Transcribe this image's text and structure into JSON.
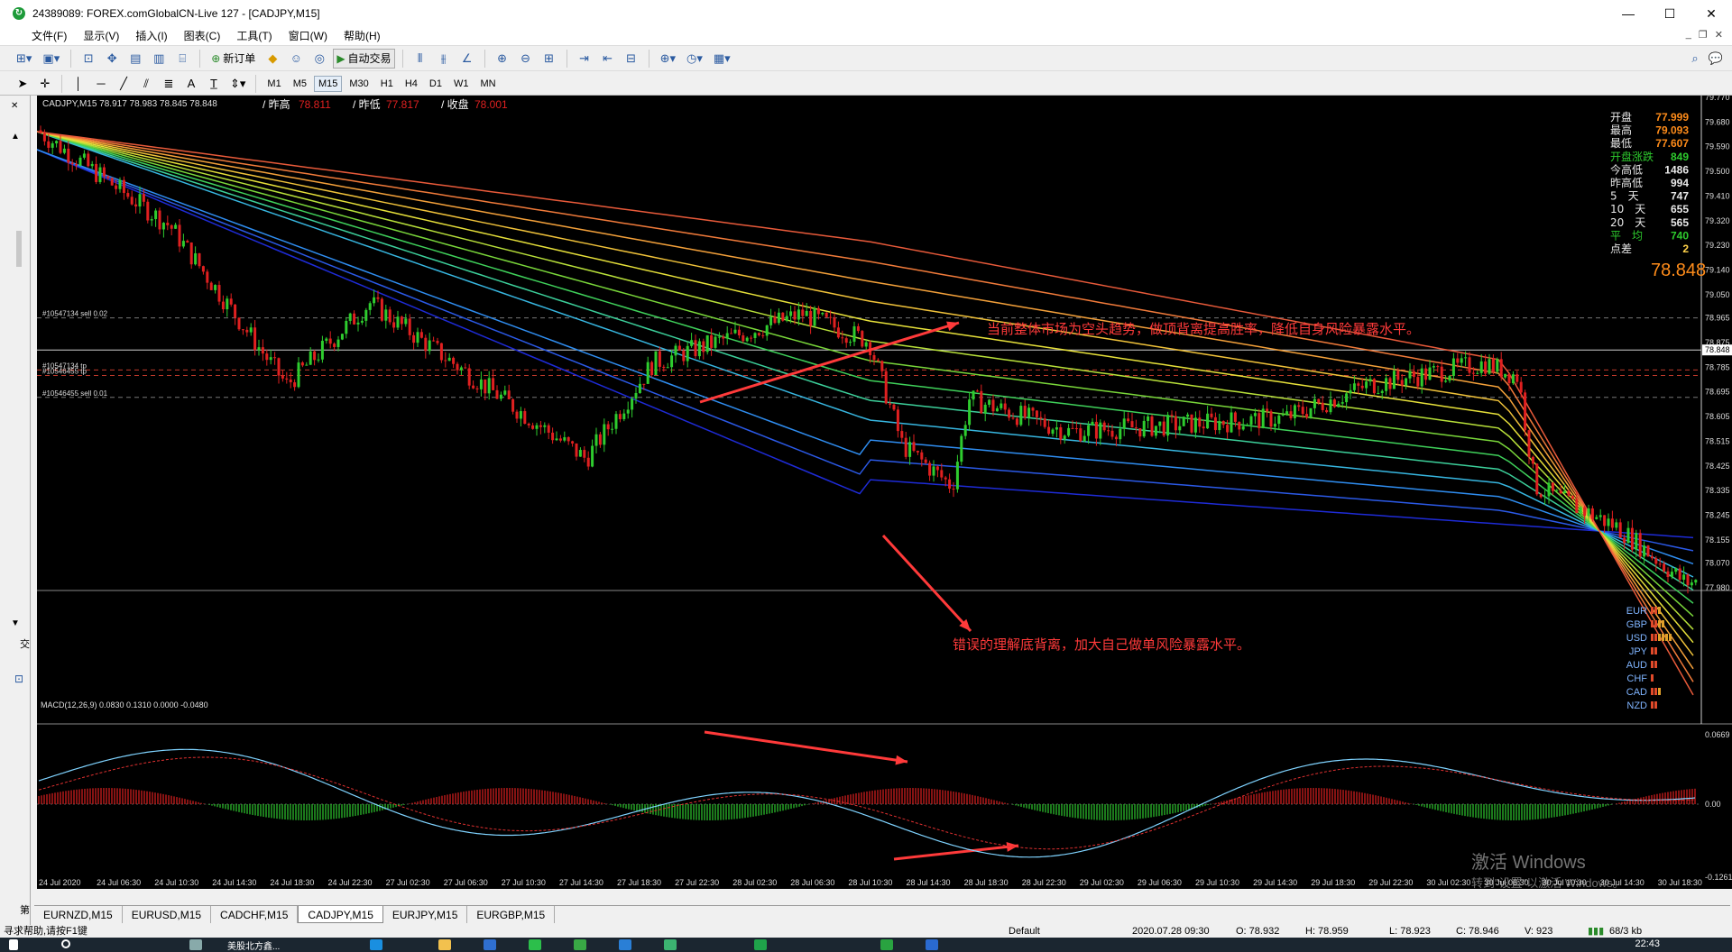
{
  "window": {
    "title": "24389089: FOREX.comGlobalCN-Live 127 - [CADJPY,M15]",
    "controls": [
      "—",
      "☐",
      "✕"
    ]
  },
  "menu": {
    "items": [
      "文件(F)",
      "显示(V)",
      "插入(I)",
      "图表(C)",
      "工具(T)",
      "窗口(W)",
      "帮助(H)"
    ]
  },
  "toolbar": {
    "new_order": "新订单",
    "auto_trade": "自动交易"
  },
  "timeframes": [
    "M1",
    "M5",
    "M15",
    "M30",
    "H1",
    "H4",
    "D1",
    "W1",
    "MN"
  ],
  "active_timeframe": "M15",
  "chart": {
    "symbol_line": "CADJPY,M15  78.917 78.983 78.845 78.848",
    "prev_high_label": "/ 昨高",
    "prev_high": "78.811",
    "prev_low_label": "/ 昨低",
    "prev_low": "77.817",
    "close_label": "/ 收盘",
    "close": "78.001",
    "orders": [
      {
        "label": "#10547134 sell 0.02",
        "price": 78.965
      },
      {
        "label": "#10547134 tp",
        "price": 78.775
      },
      {
        "label": "#10546455 tp",
        "price": 78.755
      },
      {
        "label": "#10546455 sell 0.01",
        "price": 78.675
      }
    ],
    "current_price": "78.848",
    "current_price_value": 78.848,
    "price_axis_labels": [
      "79.770",
      "79.680",
      "79.590",
      "79.500",
      "79.410",
      "79.320",
      "79.230",
      "79.140",
      "79.050",
      "78.965",
      "78.875",
      "78.848",
      "78.785",
      "78.695",
      "78.605",
      "78.515",
      "78.425",
      "78.335",
      "78.245",
      "78.155",
      "78.070",
      "77.980"
    ],
    "annotations": {
      "top": "当前整体市场为空头趋势，做顶背离提高胜率，降低自身风险暴露水平。",
      "bottom": "错误的理解底背离，加大自己做单风险暴露水平。"
    },
    "x_labels": [
      "24 Jul 2020",
      "24 Jul 06:30",
      "24 Jul 10:30",
      "24 Jul 14:30",
      "24 Jul 18:30",
      "24 Jul 22:30",
      "27 Jul 02:30",
      "27 Jul 06:30",
      "27 Jul 10:30",
      "27 Jul 14:30",
      "27 Jul 18:30",
      "27 Jul 22:30",
      "28 Jul 02:30",
      "28 Jul 06:30",
      "28 Jul 10:30",
      "28 Jul 14:30",
      "28 Jul 18:30",
      "28 Jul 22:30",
      "29 Jul 02:30",
      "29 Jul 06:30",
      "29 Jul 10:30",
      "29 Jul 14:30",
      "29 Jul 18:30",
      "29 Jul 22:30",
      "30 Jul 02:30",
      "30 Jul 06:30",
      "30 Jul 10:30",
      "30 Jul 14:30",
      "30 Jul 18:30"
    ]
  },
  "info_panel": {
    "rows": [
      {
        "label": "开盘",
        "value": "77.999",
        "color": "#ff8c1a"
      },
      {
        "label": "最高",
        "value": "79.093",
        "color": "#ff8c1a"
      },
      {
        "label": "最低",
        "value": "77.607",
        "color": "#ff8c1a"
      },
      {
        "label": "开盘涨跌",
        "value": "849",
        "color": "#2ecc2e"
      },
      {
        "label": "今高低",
        "value": "1486",
        "color": "#e8e8e8"
      },
      {
        "label": "昨高低",
        "value": "994",
        "color": "#e8e8e8"
      },
      {
        "label": "5　天",
        "value": "747",
        "color": "#e8e8e8"
      },
      {
        "label": "10　天",
        "value": "655",
        "color": "#e8e8e8"
      },
      {
        "label": "20　天",
        "value": "565",
        "color": "#e8e8e8"
      },
      {
        "label": "平　均",
        "value": "740",
        "color": "#2ecc2e"
      },
      {
        "label": "点差",
        "value": "2",
        "color": "#ffd24a"
      }
    ],
    "big_price": "78.848"
  },
  "currency_strength": [
    "EUR",
    "GBP",
    "USD",
    "JPY",
    "AUD",
    "CHF",
    "CAD",
    "NZD"
  ],
  "macd": {
    "label": "MACD(12,26,9) 0.0830 0.1310 0.0000 -0.0480",
    "axis": [
      "0.0669",
      "0.00",
      "-0.1261"
    ]
  },
  "watermark": {
    "line1": "激活 Windows",
    "line2": "转到\"设置\"以激活 Windows。"
  },
  "tabs": [
    "EURNZD,M15",
    "EURUSD,M15",
    "CADCHF,M15",
    "CADJPY,M15",
    "EURJPY,M15",
    "EURGBP,M15"
  ],
  "active_tab": "CADJPY,M15",
  "status": {
    "help": "寻求帮助,请按F1键",
    "profile": "Default",
    "datetime": "2020.07.28 09:30",
    "open": "O: 78.932",
    "high": "H: 78.959",
    "low": "L: 78.923",
    "close": "C: 78.946",
    "volume": "V: 923",
    "traffic": "68/3 kb"
  },
  "taskbar": {
    "time": "22:43",
    "app_label": "美股北方鑫..."
  },
  "colors": {
    "chart_bg": "#000000",
    "bull_candle": "#2ecc2e",
    "bear_candle": "#e02020",
    "annotation_red": "#ff3a3a",
    "macd_line": "#7fd3ff",
    "signal_line": "#e03030"
  }
}
